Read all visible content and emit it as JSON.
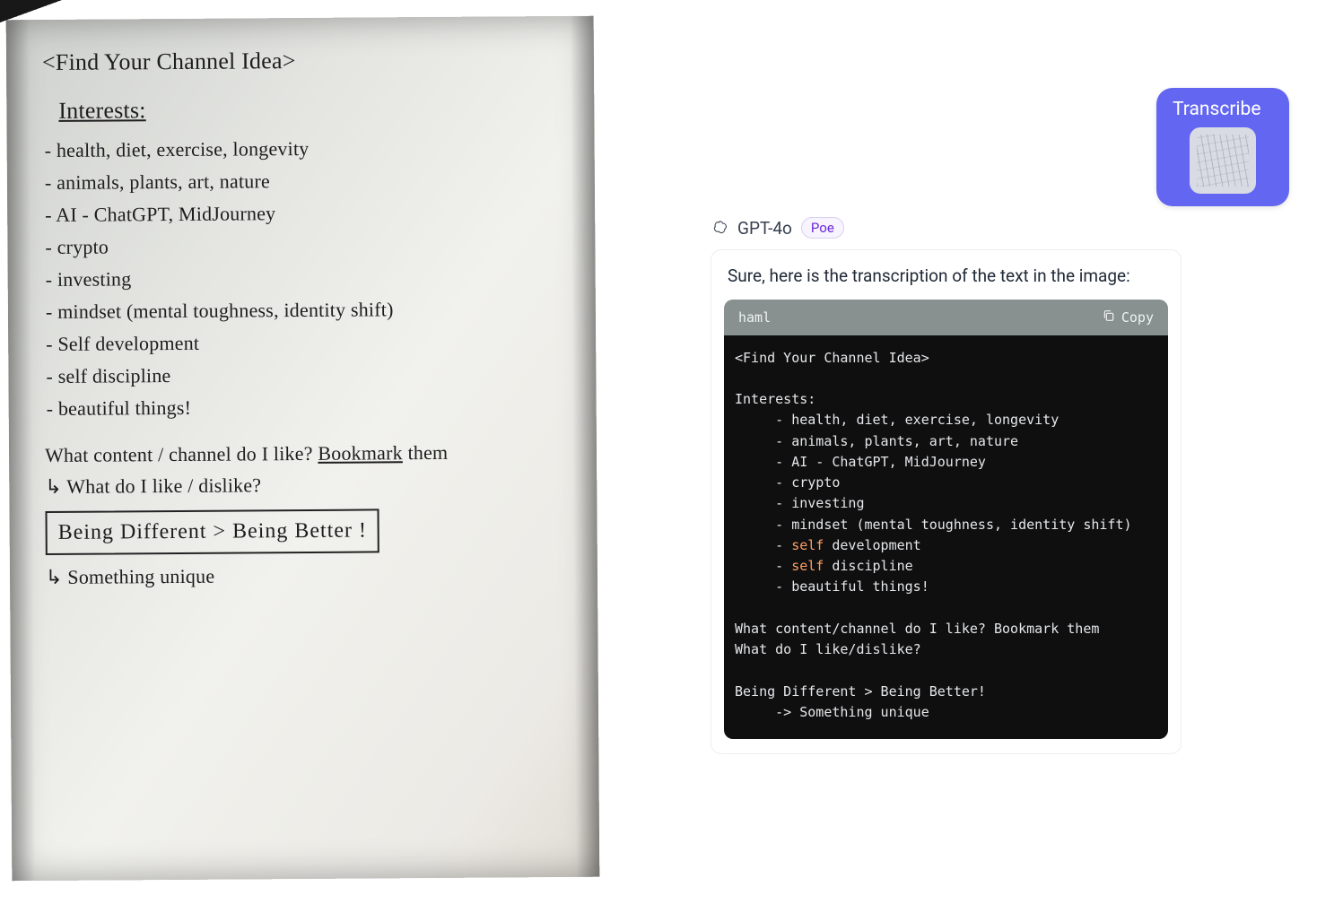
{
  "handwriting": {
    "title": "<Find Your Channel Idea>",
    "section_label": "Interests:",
    "interests": [
      "health, diet, exercise, longevity",
      "animals, plants, art, nature",
      "AI - ChatGPT, MidJourney",
      "crypto",
      "investing",
      "mindset (mental toughness, identity shift)",
      "Self development",
      "self discipline",
      "beautiful things!"
    ],
    "question1_a": "What content / channel do I like? ",
    "question1_b": "Bookmark",
    "question1_c": " them",
    "question2": "What do I like / dislike?",
    "boxed": "Being Different  >  Being Better !",
    "unique": "Something unique"
  },
  "user_message": {
    "label": "Transcribe"
  },
  "model": {
    "name": "GPT-4o",
    "platform": "Poe"
  },
  "assistant_message": {
    "intro": "Sure, here is the transcription of the text in the image:",
    "code_lang": "haml",
    "copy_label": "Copy",
    "code_lines": [
      {
        "t": "plain",
        "v": "<Find Your Channel Idea>"
      },
      {
        "t": "blank"
      },
      {
        "t": "plain",
        "v": "Interests:"
      },
      {
        "t": "bullet",
        "v": "health, diet, exercise, longevity"
      },
      {
        "t": "bullet",
        "v": "animals, plants, art, nature"
      },
      {
        "t": "bullet",
        "v": "AI - ChatGPT, MidJourney"
      },
      {
        "t": "bullet",
        "v": "crypto"
      },
      {
        "t": "bullet",
        "v": "investing"
      },
      {
        "t": "bullet",
        "v": "mindset (mental toughness, identity shift)"
      },
      {
        "t": "bullet_kw",
        "kw": "self",
        "rest": " development"
      },
      {
        "t": "bullet_kw",
        "kw": "self",
        "rest": " discipline"
      },
      {
        "t": "bullet",
        "v": "beautiful things!"
      },
      {
        "t": "blank"
      },
      {
        "t": "plain",
        "v": "What content/channel do I like? Bookmark them"
      },
      {
        "t": "plain",
        "v": "What do I like/dislike?"
      },
      {
        "t": "blank"
      },
      {
        "t": "plain",
        "v": "Being Different > Being Better!"
      },
      {
        "t": "arrow",
        "v": "Something unique"
      }
    ]
  }
}
